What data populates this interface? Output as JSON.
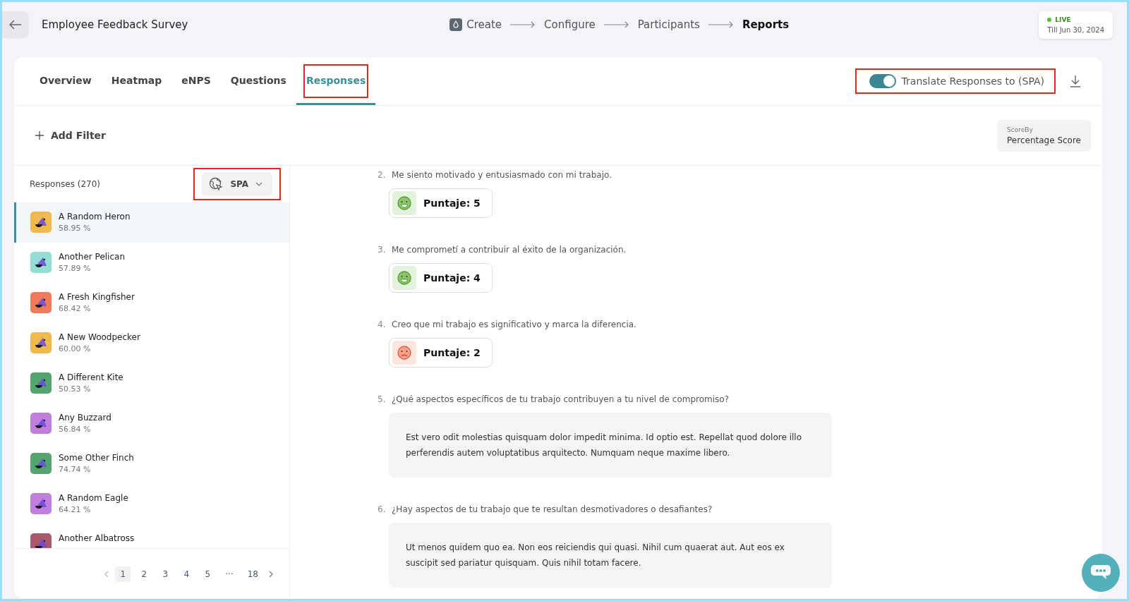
{
  "header": {
    "title": "Employee Feedback Survey",
    "steps": [
      {
        "label": "Create",
        "selected": false
      },
      {
        "label": "Configure",
        "selected": false
      },
      {
        "label": "Participants",
        "selected": false
      },
      {
        "label": "Reports",
        "selected": true
      }
    ],
    "status": {
      "label": "LIVE",
      "until": "Till Jun 30, 2024"
    }
  },
  "tabs": [
    {
      "label": "Overview",
      "selected": false,
      "highlighted": false
    },
    {
      "label": "Heatmap",
      "selected": false,
      "highlighted": false
    },
    {
      "label": "eNPS",
      "selected": false,
      "highlighted": false
    },
    {
      "label": "Questions",
      "selected": false,
      "highlighted": false
    },
    {
      "label": "Responses",
      "selected": true,
      "highlighted": true
    }
  ],
  "translate": {
    "label": "Translate Responses to (SPA)",
    "on": true,
    "highlighted": true
  },
  "filter": {
    "label": "Add Filter"
  },
  "score_by": {
    "caption": "ScoreBy",
    "value": "Percentage Score"
  },
  "responses": {
    "title": "Responses (270)",
    "language": {
      "label": "SPA",
      "highlighted": true
    },
    "items": [
      {
        "name": "A Random Heron",
        "score": "58.95 %",
        "color": "#f0b94e",
        "selected": true
      },
      {
        "name": "Another Pelican",
        "score": "57.89 %",
        "color": "#93ddd4",
        "selected": false
      },
      {
        "name": "A Fresh Kingfisher",
        "score": "68.42 %",
        "color": "#ef7a5a",
        "selected": false
      },
      {
        "name": "A New Woodpecker",
        "score": "60.00 %",
        "color": "#f0b94e",
        "selected": false
      },
      {
        "name": "A Different Kite",
        "score": "50.53 %",
        "color": "#55a56e",
        "selected": false
      },
      {
        "name": "Any Buzzard",
        "score": "56.84 %",
        "color": "#c07fdc",
        "selected": false
      },
      {
        "name": "Some Other Finch",
        "score": "74.74 %",
        "color": "#55a56e",
        "selected": false
      },
      {
        "name": "A Random Eagle",
        "score": "64.21 %",
        "color": "#c07fdc",
        "selected": false
      },
      {
        "name": "Another Albatross",
        "color": "#a85a6a",
        "selected": false
      }
    ],
    "pages": [
      {
        "label": "1",
        "selected": true
      },
      {
        "label": "2",
        "selected": false
      },
      {
        "label": "3",
        "selected": false
      },
      {
        "label": "4",
        "selected": false
      },
      {
        "label": "5",
        "selected": false
      },
      {
        "label": "···",
        "selected": false
      },
      {
        "label": "18",
        "selected": false
      }
    ]
  },
  "questions": [
    {
      "number": "2.",
      "text": "Me siento motivado y entusiasmado con mi trabajo.",
      "kind": "score",
      "answer": "Puntaje: 5",
      "positive": true
    },
    {
      "number": "3.",
      "text": "Me comprometí a contribuir al éxito de la organización.",
      "kind": "score",
      "answer": "Puntaje: 4",
      "positive": true
    },
    {
      "number": "4.",
      "text": "Creo que mi trabajo es significativo y marca la diferencia.",
      "kind": "score",
      "answer": "Puntaje: 2",
      "positive": false
    },
    {
      "number": "5.",
      "text": "¿Qué aspectos específicos de tu trabajo contribuyen a tu nivel de compromiso?",
      "kind": "text",
      "answer": "Est vero odit molestias quisquam dolor impedit minima. Id optio est. Repellat quod dolore illo perferendis autem voluptatibus arquitecto. Numquam neque maxime libero."
    },
    {
      "number": "6.",
      "text": "¿Hay aspectos de tu trabajo que te resultan desmotivadores o desafiantes?",
      "kind": "text",
      "answer": "Ut menos quidem quo ea. Non eos reiciendis qui quasi. Nihil cum quaerat aut. Aut eos ex suscipit sed pariatur quisquam. Quis nihil totam facere."
    }
  ]
}
